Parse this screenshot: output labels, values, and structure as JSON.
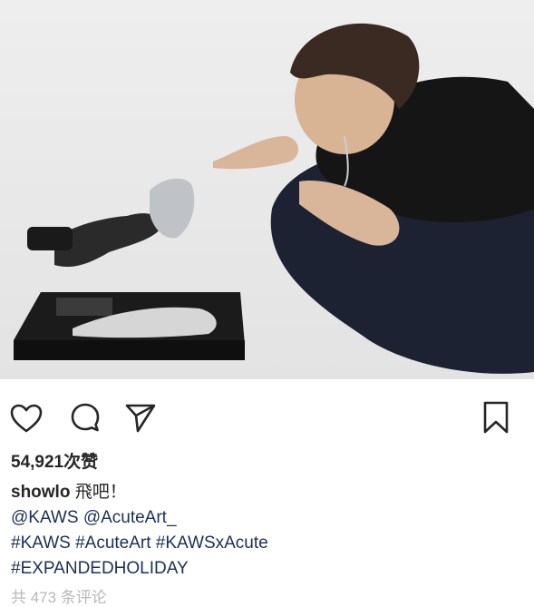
{
  "post": {
    "image_alt": "photo",
    "likes": "54,921次赞",
    "username": "showlo",
    "caption_text": " 飛吧！",
    "mentions_line": "@KAWS @AcuteArt_",
    "hashtags_line": "#KAWS #AcuteArt #KAWSxAcute",
    "hashtags_line2": "#EXPANDEDHOLIDAY",
    "comments_text": "共 473 条评论"
  },
  "icons": {
    "like": "heart-icon",
    "comment": "comment-icon",
    "share": "send-icon",
    "save": "bookmark-icon"
  }
}
